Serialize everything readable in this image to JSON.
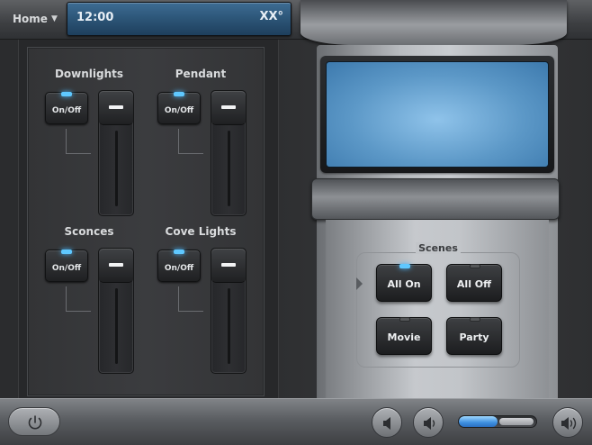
{
  "topbar": {
    "home_label": "Home",
    "time": "12:00",
    "temperature": "XX°"
  },
  "lights": [
    {
      "name": "Downlights",
      "onoff_label": "On/Off",
      "led_on": true,
      "level": 1.0
    },
    {
      "name": "Pendant",
      "onoff_label": "On/Off",
      "led_on": true,
      "level": 1.0
    },
    {
      "name": "Sconces",
      "onoff_label": "On/Off",
      "led_on": true,
      "level": 1.0
    },
    {
      "name": "Cove Lights",
      "onoff_label": "On/Off",
      "led_on": true,
      "level": 1.0
    }
  ],
  "scenes": {
    "title": "Scenes",
    "buttons": [
      {
        "label": "All On",
        "active": true
      },
      {
        "label": "All Off",
        "active": false
      },
      {
        "label": "Movie",
        "active": false
      },
      {
        "label": "Party",
        "active": false
      }
    ]
  },
  "bottombar": {
    "volume_level": 0.5
  },
  "colors": {
    "led_active": "#5fc8ff",
    "screen": "#5c98c7",
    "clock_panel": "#2c5577"
  },
  "icons": [
    "power-icon",
    "volume-mute-icon",
    "volume-down-icon",
    "volume-up-icon",
    "caret-down-icon"
  ]
}
